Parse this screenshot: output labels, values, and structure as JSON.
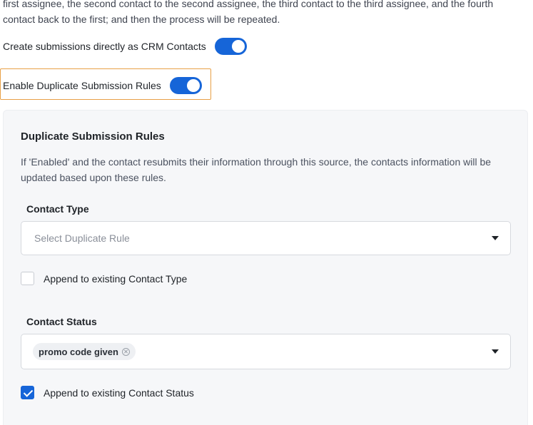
{
  "intro": {
    "line1": "first assignee, the second contact to the second assignee, the third contact to the third assignee, and the fourth",
    "line2": "contact back to the first; and then the process will be repeated."
  },
  "toggles": {
    "crm_contacts": {
      "label": "Create submissions directly as CRM Contacts",
      "enabled": true
    },
    "duplicate_rules": {
      "label": "Enable Duplicate Submission Rules",
      "enabled": true
    }
  },
  "panel": {
    "title": "Duplicate Submission Rules",
    "description": "If 'Enabled' and the contact resubmits their information through this source, the contacts information will be updated based upon these rules.",
    "contact_type": {
      "label": "Contact Type",
      "placeholder": "Select Duplicate Rule",
      "append_label": "Append to existing Contact Type",
      "append_checked": false
    },
    "contact_status": {
      "label": "Contact Status",
      "selected_tags": [
        "promo code given"
      ],
      "append_label": "Append to existing Contact Status",
      "append_checked": true
    }
  },
  "colors": {
    "accent": "#1665d8",
    "highlight_border": "#e8a046",
    "panel_bg": "#f6f7f9"
  }
}
